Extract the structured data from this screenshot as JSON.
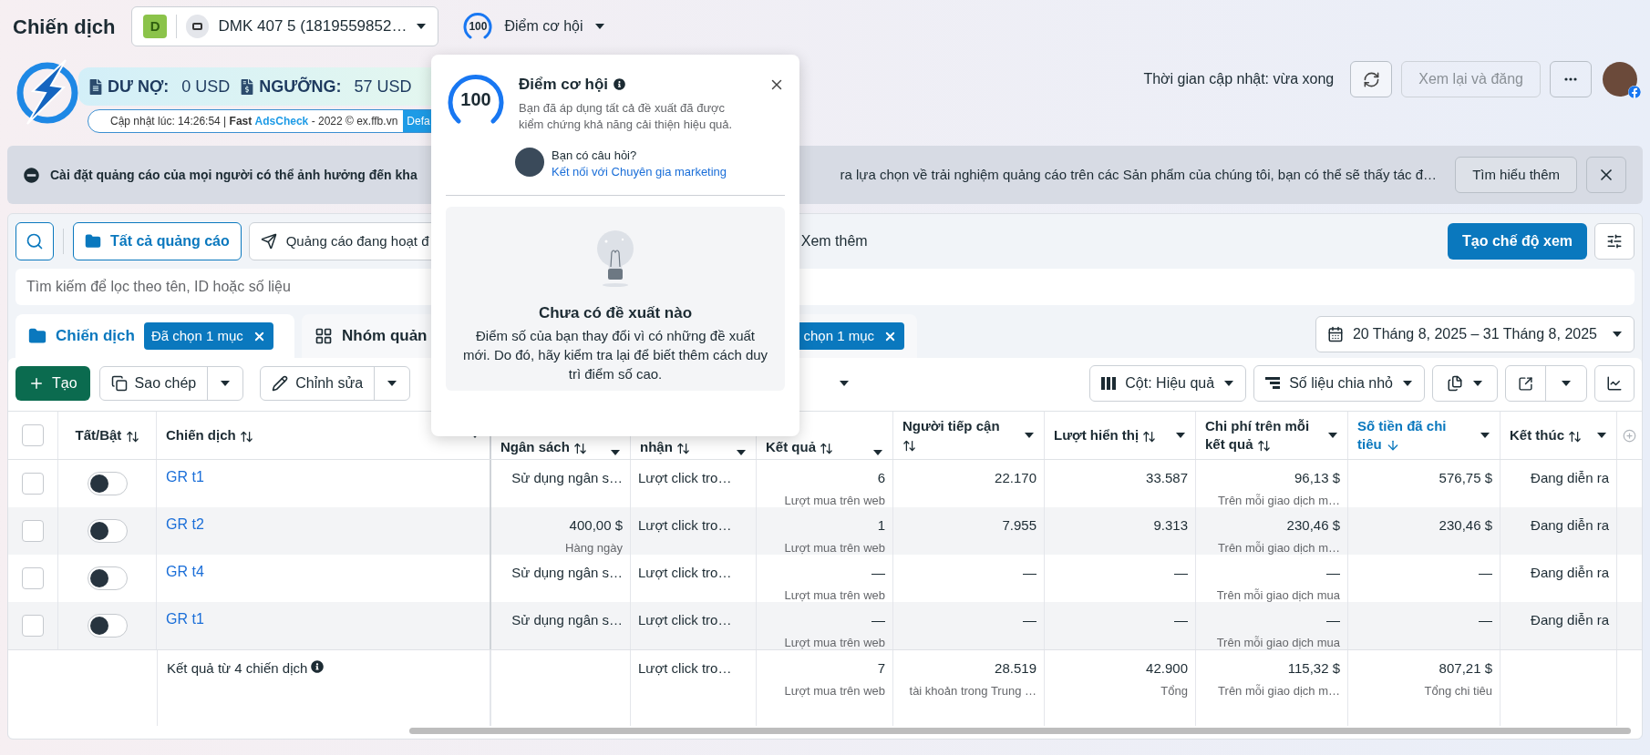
{
  "header": {
    "title": "Chiến dịch",
    "account": {
      "initial": "D",
      "name": "DMK 407 5 (1819559852…"
    },
    "score": {
      "value": "100",
      "label": "Điểm cơ hội"
    }
  },
  "balance": {
    "debt_label": "DƯ NỢ:",
    "debt_value": "0 USD",
    "threshold_label": "NGƯỠNG:",
    "threshold_value": "57 USD",
    "updated_prefix": "Cập nhật lúc: 14:26:54 |",
    "brand_first": "Fast",
    "brand_second": "AdsCheck",
    "updated_suffix": "- 2022 © ex.ffb.vn",
    "tag": "Defa"
  },
  "update_status": "Thời gian cập nhật: vừa xong",
  "review_button": {
    "label": "Xem lại và đăng",
    "disabled": true
  },
  "notice": {
    "text_start": "Cài đặt quảng cáo của mọi người có thể ảnh hưởng đến kha",
    "text_end": "ra lựa chọn về trải nghiệm quảng cáo trên các Sản phẩm của chúng tôi, bạn có thể sẽ thấy tác đ…",
    "learn_more": "Tìm hiểu thêm"
  },
  "filters": {
    "tabs": [
      {
        "label": "Tất cả quảng cáo",
        "selected": true
      },
      {
        "label": "Quảng cáo đang hoạt đ",
        "selected": false
      }
    ],
    "more": "Xem thêm",
    "create_view": "Tạo chế độ xem",
    "search_placeholder": "Tìm kiếm để lọc theo tên, ID hoặc số liệu"
  },
  "levels": [
    {
      "label": "Chiến dịch",
      "badge": "Đã chọn 1 mục",
      "selected": true
    },
    {
      "label": "Nhóm quản",
      "badge": "chọn 1 mục",
      "selected": false
    }
  ],
  "date_range": "20 Tháng 8, 2025 – 31 Tháng 8, 2025",
  "toolbar": {
    "create": "Tạo",
    "duplicate": "Sao chép",
    "edit": "Chỉnh sửa",
    "columns": "Cột: Hiệu quả",
    "breakdown": "Số liệu chia nhỏ"
  },
  "table": {
    "columns": [
      {
        "label": "Tất/Bật",
        "sorted": false
      },
      {
        "label": "Chiến dịch",
        "sorted": false
      },
      {
        "label": "Ngân sách",
        "sorted": false
      },
      {
        "label": "nhận",
        "sorted": false
      },
      {
        "label": "Kết quả",
        "sorted": false
      },
      {
        "label": "Người tiếp cận",
        "sorted": false
      },
      {
        "label": "Lượt hiển thị",
        "sorted": false
      },
      {
        "label": "Chi phí trên mỗi kết quả",
        "sorted": false
      },
      {
        "label": "Số tiền đã chi tiêu",
        "sorted": true
      },
      {
        "label": "Kết thúc",
        "sorted": false
      }
    ],
    "select_all_checked": false,
    "rows": [
      {
        "checked": false,
        "cells": [
          {
            "kind": "toggle",
            "on": false
          },
          {
            "kind": "link",
            "text": "GR t1"
          },
          {
            "kind": "text",
            "text": "Sử dụng ngân s…"
          },
          {
            "kind": "text",
            "text": "Lượt click tro…"
          },
          {
            "kind": "text",
            "text": "6",
            "sub": "Lượt mua trên web"
          },
          {
            "kind": "text",
            "text": "22.170"
          },
          {
            "kind": "text",
            "text": "33.587"
          },
          {
            "kind": "text",
            "text": "96,13 $",
            "sub": "Trên mỗi giao dịch m…"
          },
          {
            "kind": "text",
            "text": "576,75 $"
          },
          {
            "kind": "text",
            "text": "Đang diễn ra"
          }
        ]
      },
      {
        "checked": false,
        "cells": [
          {
            "kind": "toggle",
            "on": false
          },
          {
            "kind": "link",
            "text": "GR t2"
          },
          {
            "kind": "text",
            "text": "400,00 $",
            "sub": "Hàng ngày"
          },
          {
            "kind": "text",
            "text": "Lượt click tro…"
          },
          {
            "kind": "text",
            "text": "1",
            "sub": "Lượt mua trên web"
          },
          {
            "kind": "text",
            "text": "7.955"
          },
          {
            "kind": "text",
            "text": "9.313"
          },
          {
            "kind": "text",
            "text": "230,46 $",
            "sub": "Trên mỗi giao dịch m…"
          },
          {
            "kind": "text",
            "text": "230,46 $"
          },
          {
            "kind": "text",
            "text": "Đang diễn ra"
          }
        ]
      },
      {
        "checked": false,
        "cells": [
          {
            "kind": "toggle",
            "on": false
          },
          {
            "kind": "link",
            "text": "GR t4"
          },
          {
            "kind": "text",
            "text": "Sử dụng ngân s…"
          },
          {
            "kind": "text",
            "text": "Lượt click tro…"
          },
          {
            "kind": "text",
            "text": "—",
            "sub": "Lượt mua trên web"
          },
          {
            "kind": "text",
            "text": "—"
          },
          {
            "kind": "text",
            "text": "—"
          },
          {
            "kind": "text",
            "text": "—",
            "sub": "Trên mỗi giao dịch mua"
          },
          {
            "kind": "text",
            "text": "—"
          },
          {
            "kind": "text",
            "text": "Đang diễn ra"
          }
        ]
      },
      {
        "checked": false,
        "cells": [
          {
            "kind": "toggle",
            "on": false
          },
          {
            "kind": "link",
            "text": "GR t1"
          },
          {
            "kind": "text",
            "text": "Sử dụng ngân s…"
          },
          {
            "kind": "text",
            "text": "Lượt click tro…"
          },
          {
            "kind": "text",
            "text": "—",
            "sub": "Lượt mua trên web"
          },
          {
            "kind": "text",
            "text": "—"
          },
          {
            "kind": "text",
            "text": "—"
          },
          {
            "kind": "text",
            "text": "—",
            "sub": "Trên mỗi giao dịch mua"
          },
          {
            "kind": "text",
            "text": "—"
          },
          {
            "kind": "text",
            "text": "Đang diễn ra"
          }
        ]
      }
    ],
    "summary": {
      "cells": [
        null,
        {
          "kind": "label",
          "text": "Kết quả từ 4 chiến dịch"
        },
        null,
        {
          "kind": "text",
          "text": "Lượt click tro…"
        },
        {
          "kind": "text",
          "text": "7",
          "sub": "Lượt mua trên web"
        },
        {
          "kind": "text",
          "text": "28.519",
          "sub": "tài khoản trong Trung …"
        },
        {
          "kind": "text",
          "text": "42.900",
          "sub": "Tổng"
        },
        {
          "kind": "text",
          "text": "115,32 $",
          "sub": "Trên mỗi giao dịch m…"
        },
        {
          "kind": "text",
          "text": "807,21 $",
          "sub": "Tổng chi tiêu"
        },
        null
      ]
    }
  },
  "popover": {
    "score": "100",
    "title": "Điểm cơ hội",
    "description": "Bạn đã áp dụng tất cả đề xuất đã được kiểm chứng khả năng cải thiện hiệu quả.",
    "question": "Bạn có câu hỏi?",
    "link": "Kết nối với Chuyên gia marketing",
    "empty_title": "Chưa có đề xuất nào",
    "empty_text": "Điểm số của bạn thay đổi vì có những đề xuất mới. Do đó, hãy kiểm tra lại để biết thêm cách duy trì điểm số cao."
  }
}
